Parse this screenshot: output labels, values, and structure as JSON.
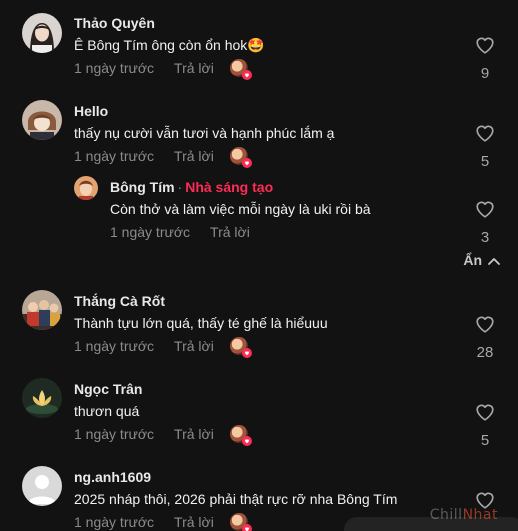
{
  "comments": [
    {
      "username": "Thảo Quyên",
      "text": "Ê Bông Tím ông còn ổn hok🤩",
      "time": "1 ngày trước",
      "reply_label": "Trả lời",
      "likes": "9",
      "avatar": "girl-portrait"
    },
    {
      "username": "Hello",
      "text": "thấy nụ cười vẫn tươi và hạnh phúc lắm ạ",
      "time": "1 ngày trước",
      "reply_label": "Trả lời",
      "likes": "5",
      "avatar": "anime-character"
    },
    {
      "username": "Thắng Cà Rốt",
      "text": "Thành tựu lớn quá, thấy té ghế là hiểuuu",
      "time": "1 ngày trước",
      "reply_label": "Trả lời",
      "likes": "28",
      "avatar": "group-photo"
    },
    {
      "username": "Ngọc Trân",
      "text": "thươn quá",
      "time": "1 ngày trước",
      "reply_label": "Trả lời",
      "likes": "5",
      "avatar": "lotus-flower"
    },
    {
      "username": "ng.anh1609",
      "text": "2025 nháp thôi, 2026 phải thật rực rỡ nha Bông Tím",
      "time": "1 ngày trước",
      "reply_label": "Trả lời",
      "likes": "",
      "avatar": "default-user"
    }
  ],
  "reply": {
    "username": "Bông Tím",
    "separator": "·",
    "creator_label": "Nhà sáng tạo",
    "text": "Còn thở và làm việc mỗi ngày là uki rồi bà",
    "time": "1 ngày trước",
    "reply_label": "Trả lời",
    "likes": "3"
  },
  "hide_replies_label": "Ẩn",
  "watermark": {
    "part1": "Chill",
    "part2": "Nhat"
  },
  "colors": {
    "background": "#121212",
    "creator": "#fe2c55",
    "muted": "#8b8b8b"
  },
  "icons": [
    "heart-outline-icon",
    "chevron-up-icon",
    "heart-badge-icon"
  ]
}
